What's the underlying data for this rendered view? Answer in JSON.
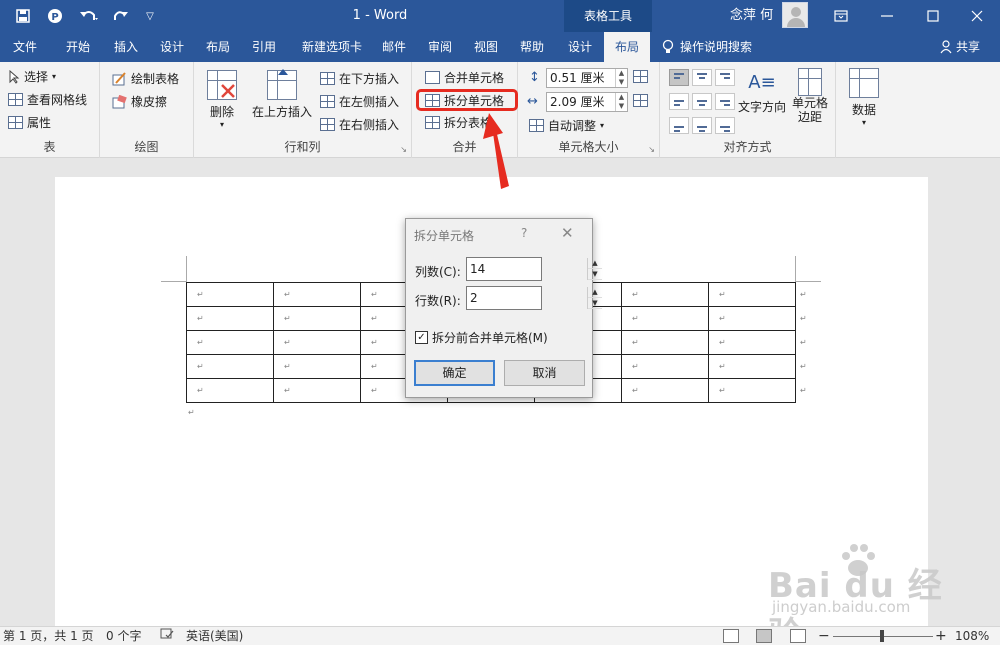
{
  "titlebar": {
    "document_title": "1  -  Word",
    "context_tab": "表格工具",
    "user_name": "念萍 何",
    "icons": [
      "save-icon",
      "sync-icon",
      "undo-icon",
      "redo-icon",
      "customize-qat-icon",
      "ribbon-display-icon",
      "minimize-icon",
      "maximize-icon",
      "close-icon"
    ]
  },
  "tabs": [
    {
      "label": "文件"
    },
    {
      "label": "开始"
    },
    {
      "label": "插入"
    },
    {
      "label": "设计"
    },
    {
      "label": "布局"
    },
    {
      "label": "引用"
    },
    {
      "label": "新建选项卡"
    },
    {
      "label": "邮件"
    },
    {
      "label": "审阅"
    },
    {
      "label": "视图"
    },
    {
      "label": "帮助"
    },
    {
      "label": "设计"
    },
    {
      "label": "布局"
    }
  ],
  "tell_me": "操作说明搜索",
  "share": "共享",
  "ribbon": {
    "table_group": {
      "label": "表",
      "select": "选择",
      "view_gridlines": "查看网格线",
      "properties": "属性"
    },
    "draw_group": {
      "label": "绘图",
      "draw_table": "绘制表格",
      "eraser": "橡皮擦"
    },
    "rows_cols_group": {
      "label": "行和列",
      "delete": "删除",
      "insert_above": "在上方插入",
      "insert_below": "在下方插入",
      "insert_left": "在左侧插入",
      "insert_right": "在右侧插入"
    },
    "merge_group": {
      "label": "合并",
      "merge_cells": "合并单元格",
      "split_cells": "拆分单元格",
      "split_table": "拆分表格"
    },
    "cell_size_group": {
      "label": "单元格大小",
      "height": "0.51 厘米",
      "width": "2.09 厘米",
      "autofit": "自动调整"
    },
    "alignment_group": {
      "label": "对齐方式",
      "text_direction": "文字方向",
      "cell_margins": "单元格\n边距"
    },
    "data_group": {
      "label": "数据"
    }
  },
  "document": {
    "table_rows": 5,
    "table_cols": 7,
    "para_mark": "↵"
  },
  "dialog": {
    "title": "拆分单元格",
    "help": "?",
    "close": "✕",
    "columns_label": "列数(C):",
    "columns_value": "14",
    "rows_label": "行数(R):",
    "rows_value": "2",
    "merge_before_split_label": "拆分前合并单元格(M)",
    "merge_before_split_checked": true,
    "ok": "确定",
    "cancel": "取消"
  },
  "statusbar": {
    "page": "第 1 页，共 1 页",
    "words": "0 个字",
    "language": "英语(美国)",
    "zoom": "108%",
    "zoom_minus": "−",
    "zoom_plus": "+"
  },
  "watermark": {
    "brand": "Bai du 经验",
    "url": "jingyan.baidu.com"
  },
  "colors": {
    "accent": "#2b579a",
    "highlight": "#e62b20"
  }
}
